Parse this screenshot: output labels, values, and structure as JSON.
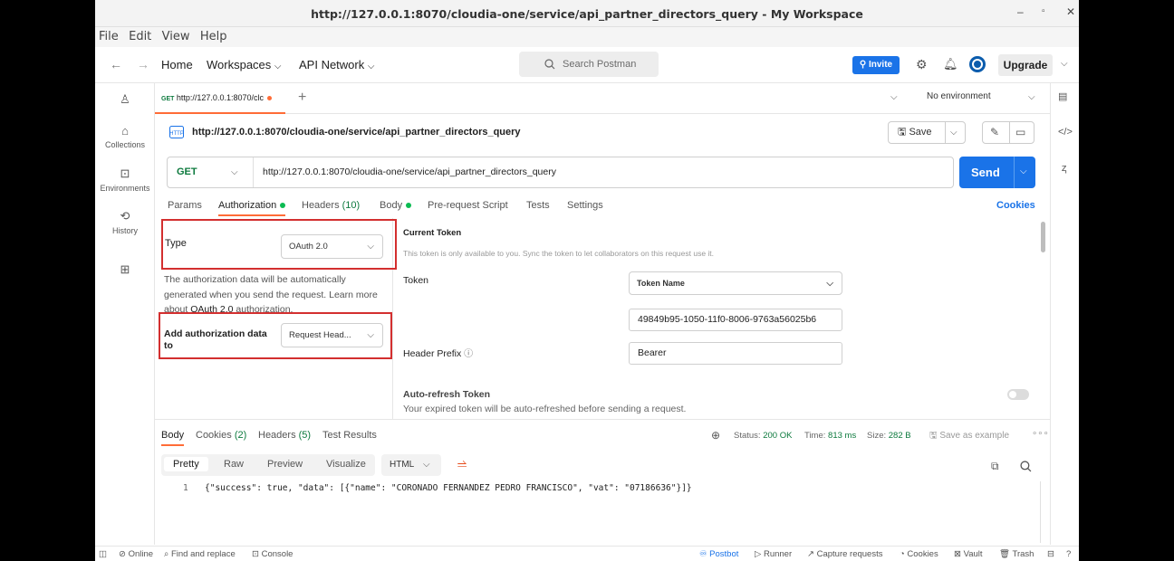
{
  "window": {
    "title": "http://127.0.0.1:8070/cloudia-one/service/api_partner_directors_query - My Workspace",
    "controls": [
      "–",
      "▫",
      "✕"
    ]
  },
  "menu": [
    "File",
    "Edit",
    "View",
    "Help"
  ],
  "header": {
    "home": "Home",
    "workspaces": "Workspaces",
    "api_network": "API Network",
    "search_placeholder": "Search Postman",
    "invite": "Invite",
    "upgrade": "Upgrade"
  },
  "sidebar": {
    "items": [
      {
        "label": "",
        "icon": "user-icon"
      },
      {
        "label": "Collections",
        "icon": "trash-can-icon"
      },
      {
        "label": "Environments",
        "icon": "environment-icon"
      },
      {
        "label": "History",
        "icon": "history-icon"
      },
      {
        "label": "",
        "icon": "grid-plus-icon"
      }
    ]
  },
  "tabs": {
    "active_method": "GET",
    "active_label": "http://127.0.0.1:8070/clc",
    "environment": "No environment"
  },
  "request": {
    "title": "http://127.0.0.1:8070/cloudia-one/service/api_partner_directors_query",
    "save_label": "Save",
    "method": "GET",
    "url": "http://127.0.0.1:8070/cloudia-one/service/api_partner_directors_query",
    "send_label": "Send"
  },
  "subtabs": {
    "params": "Params",
    "authorization": "Authorization",
    "headers": "Headers",
    "headers_count": "(10)",
    "body": "Body",
    "prerequest": "Pre-request Script",
    "tests": "Tests",
    "settings": "Settings",
    "cookies": "Cookies"
  },
  "auth": {
    "type_label": "Type",
    "type_value": "OAuth 2.0",
    "desc_1": "The authorization data will be automatically generated when you send the request. Learn more about",
    "desc_link": "OAuth 2.0",
    "desc_2": "authorization.",
    "add_to_label": "Add authorization data to",
    "add_to_value": "Request Head...",
    "current_token": "Current Token",
    "token_note": "This token is only available to you. Sync the token to let collaborators on this request use it.",
    "token_label": "Token",
    "token_name": "Token Name",
    "token_value": "49849b95-1050-11f0-8006-9763a56025b6",
    "prefix_label": "Header Prefix",
    "prefix_value": "Bearer",
    "autorefresh_title": "Auto-refresh Token",
    "autorefresh_desc": "Your expired token will be auto-refreshed before sending a request."
  },
  "response": {
    "tabs": {
      "body": "Body",
      "cookies": "Cookies",
      "cookies_count": "(2)",
      "headers": "Headers",
      "headers_count": "(5)",
      "tests": "Test Results"
    },
    "status_label": "Status:",
    "status_value": "200 OK",
    "time_label": "Time:",
    "time_value": "813 ms",
    "size_label": "Size:",
    "size_value": "282 B",
    "save_example": "Save as example",
    "views": [
      "Pretty",
      "Raw",
      "Preview",
      "Visualize"
    ],
    "format": "HTML",
    "line_number": "1",
    "body_line": "{\"success\": true, \"data\": [{\"name\": \"CORONADO FERNANDEZ PEDRO FRANCISCO\", \"vat\": \"07186636\"}]}"
  },
  "statusbar": {
    "online": "Online",
    "find": "Find and replace",
    "console": "Console",
    "postbot": "Postbot",
    "runner": "Runner",
    "capture": "Capture requests",
    "cookies": "Cookies",
    "vault": "Vault",
    "trash": "Trash"
  },
  "colors": {
    "accent": "#ff6c37",
    "primary": "#1a73e8",
    "get_method": "#0d7a3e",
    "highlight_box": "#d32f2f"
  }
}
